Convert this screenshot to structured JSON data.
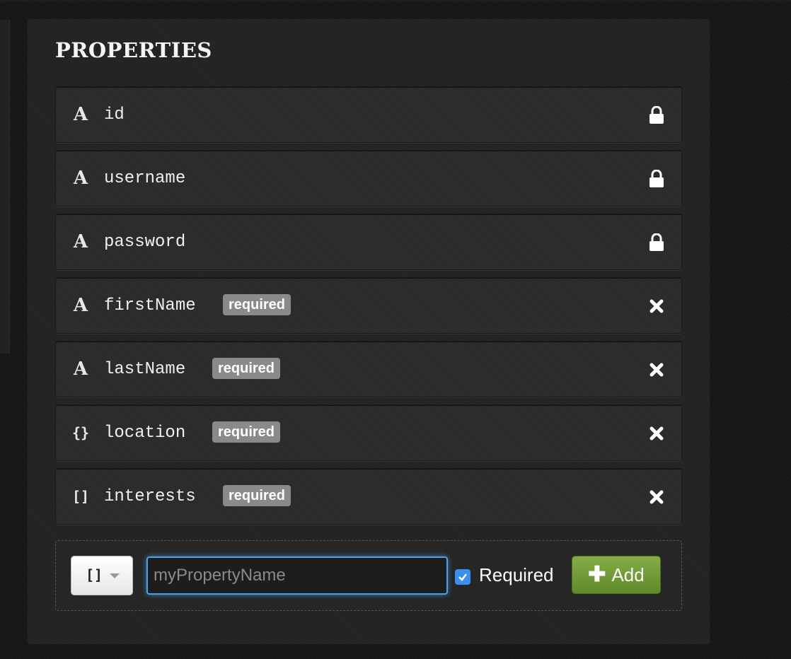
{
  "panel": {
    "title": "PROPERTIES"
  },
  "properties": [
    {
      "type_icon": "A",
      "icon_name": "string-type-icon",
      "name": "id",
      "required": false,
      "badge": "",
      "action": "lock-icon"
    },
    {
      "type_icon": "A",
      "icon_name": "string-type-icon",
      "name": "username",
      "required": false,
      "badge": "",
      "action": "lock-icon"
    },
    {
      "type_icon": "A",
      "icon_name": "string-type-icon",
      "name": "password",
      "required": false,
      "badge": "",
      "action": "lock-icon"
    },
    {
      "type_icon": "A",
      "icon_name": "string-type-icon",
      "name": "firstName",
      "required": true,
      "badge": "required",
      "action": "remove-icon"
    },
    {
      "type_icon": "A",
      "icon_name": "string-type-icon",
      "name": "lastName",
      "required": true,
      "badge": "required",
      "action": "remove-icon"
    },
    {
      "type_icon": "{}",
      "icon_name": "object-type-icon",
      "name": "location",
      "required": true,
      "badge": "required",
      "action": "remove-icon"
    },
    {
      "type_icon": "[]",
      "icon_name": "array-type-icon",
      "name": "interests",
      "required": true,
      "badge": "required",
      "action": "remove-icon"
    }
  ],
  "add_form": {
    "type_value": "[]",
    "name_placeholder": "myPropertyName",
    "name_value": "",
    "required_checked": true,
    "required_label": "Required",
    "add_label": "Add",
    "add_icon": "plus-icon"
  },
  "colors": {
    "badge": "#8a8a8a",
    "add_button": "#6f9a34",
    "input_focus": "#4aa3e8",
    "checkbox": "#3b8ff0"
  }
}
